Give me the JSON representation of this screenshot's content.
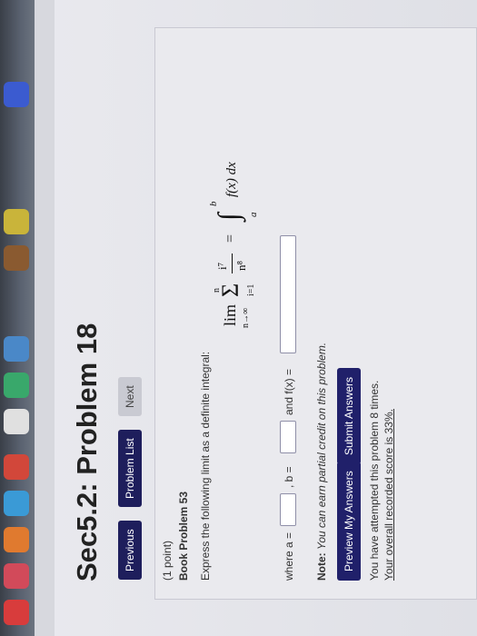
{
  "title": "Sec5.2: Problem 18",
  "nav": {
    "previous": "Previous",
    "problem_list": "Problem List",
    "next": "Next"
  },
  "problem": {
    "points": "(1 point)",
    "book_ref": "Book Problem 53",
    "instruction": "Express the following limit as a definite integral:",
    "formula": {
      "lim": "lim",
      "lim_sub": "n→∞",
      "sum": "Σ",
      "sum_top": "n",
      "sum_bottom": "i=1",
      "numerator": "i⁷",
      "denominator": "n⁸",
      "equals": "=",
      "integral": "∫",
      "int_upper": "b",
      "int_lower": "a",
      "integrand": "f(x) dx"
    },
    "where_a": "where a =",
    "comma_b": ", b =",
    "and_f": "and f(x) =",
    "note_label": "Note:",
    "note_text": "You can earn partial credit on this problem."
  },
  "actions": {
    "preview": "Preview My Answers",
    "submit": "Submit Answers"
  },
  "status": {
    "attempts": "You have attempted this problem 8 times.",
    "score": "Your overall recorded score is 33%."
  }
}
